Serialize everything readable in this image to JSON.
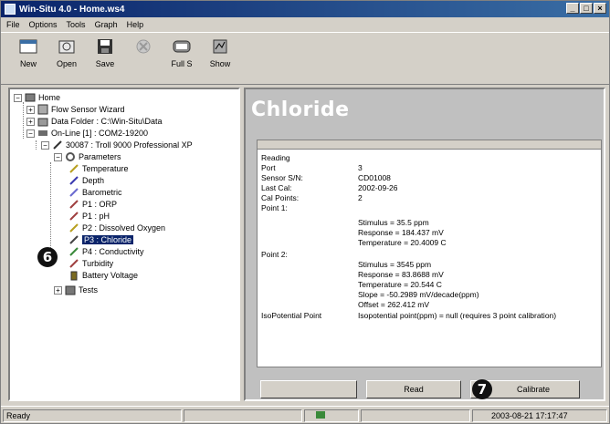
{
  "window": {
    "title": "Win-Situ 4.0 - Home.ws4",
    "controls": [
      "_",
      "□",
      "×"
    ]
  },
  "menu": [
    "File",
    "Options",
    "Tools",
    "Graph",
    "Help"
  ],
  "toolbar": [
    {
      "label": "New",
      "icon": "new-icon",
      "enabled": true
    },
    {
      "label": "Open",
      "icon": "open-icon",
      "enabled": true
    },
    {
      "label": "Save",
      "icon": "save-icon",
      "enabled": true
    },
    {
      "label": "",
      "icon": "disabled-icon",
      "enabled": false
    },
    {
      "label": "Full S",
      "icon": "full-screen-icon",
      "enabled": true
    },
    {
      "label": "Show",
      "icon": "show-icon",
      "enabled": true
    }
  ],
  "tree": {
    "home": "Home",
    "flow_wizard": "Flow Sensor Wizard",
    "data_folder": "Data Folder : C:\\Win-Situ\\Data",
    "online": "On-Line [1] : COM2-19200",
    "device": "30087 : Troll 9000 Professional XP",
    "parameters": "Parameters",
    "items": [
      "Temperature",
      "Depth",
      "Barometric",
      "P1 : ORP",
      "P1 : pH",
      "P2 : Dissolved Oxygen",
      "P3 : Chloride",
      "P4 : Conductivity",
      "Turbidity",
      "Battery Voltage"
    ],
    "selected_index": 6,
    "tests": "Tests"
  },
  "callouts": {
    "left": "6",
    "calibrate": "7"
  },
  "detail": {
    "heading": "Chloride",
    "rows": [
      {
        "label": "Reading",
        "value": ""
      },
      {
        "label": "Port",
        "value": "3"
      },
      {
        "label": "Sensor S/N:",
        "value": "CD01008"
      },
      {
        "label": "Last Cal:",
        "value": "2002-09-26"
      },
      {
        "label": "Cal Points:",
        "value": "2"
      },
      {
        "label": "Point 1:",
        "value": ""
      },
      {
        "label": "",
        "value": "Stimulus = 35.5 ppm"
      },
      {
        "label": "",
        "value": "Response = 184.437 mV"
      },
      {
        "label": "",
        "value": "Temperature = 20.4009 C"
      },
      {
        "label": "Point 2:",
        "value": ""
      },
      {
        "label": "",
        "value": "Stimulus = 3545 ppm"
      },
      {
        "label": "",
        "value": "Response = 83.8688 mV"
      },
      {
        "label": "",
        "value": "Temperature = 20.544 C"
      },
      {
        "label": "",
        "value": "Slope = -50.2989 mV/decade(ppm)"
      },
      {
        "label": "",
        "value": "Offset = 262.412 mV"
      },
      {
        "label": "IsoPotential Point",
        "value": "Isopotential point(ppm) = null (requires 3 point calibration)"
      }
    ],
    "buttons": {
      "left": "",
      "read": "Read",
      "calibrate": "Calibrate"
    }
  },
  "status": {
    "text": "Ready",
    "datetime": "2003-08-21  17:17:47"
  }
}
